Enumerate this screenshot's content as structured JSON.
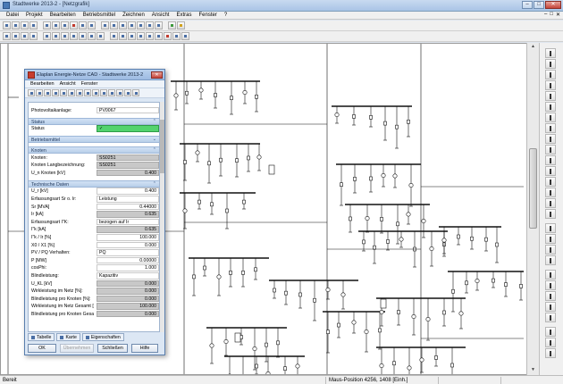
{
  "window": {
    "title": "Stadtwerke 2013-2 - [Netzgrafik]",
    "controls": [
      "–",
      "□",
      "✕"
    ]
  },
  "menu": {
    "items": [
      "Datei",
      "Projekt",
      "Bearbeiten",
      "Betriebsmittel",
      "Zeichnen",
      "Ansicht",
      "Extras",
      "Fenster",
      "?"
    ],
    "mdi_controls": [
      "–",
      "□",
      "✕"
    ]
  },
  "dialog": {
    "title": "Elaplan Energie-Netze CAD - Stadtwerke 2013-2",
    "menu": [
      "Bearbeiten",
      "Ansicht",
      "Fenster"
    ],
    "photovoltaik_label": "Photovoltaikanlage:",
    "photovoltaik_value": "PV0067",
    "sections": {
      "status": "Status",
      "betriebsmittel": "Betriebsmittel",
      "knoten": "Knoten",
      "technische_daten": "Technische Daten"
    },
    "status_row": {
      "label": "Status",
      "value": "✓"
    },
    "knoten_rows": [
      {
        "label": "Knoten:",
        "value": "SS0251",
        "style": "grey"
      },
      {
        "label": "Knoten Langbezeichnung:",
        "value": "SS0251",
        "style": "grey"
      },
      {
        "label": "U_n Knoten [kV]",
        "value": "0.400",
        "style": "grey num"
      }
    ],
    "tech_rows": [
      {
        "label": "U_r [kV]",
        "value": "0.400",
        "style": "num"
      },
      {
        "label": "Erfassungsart Sr o. Ir:",
        "value": "Leistung",
        "style": ""
      },
      {
        "label": "Sr [MVA]",
        "value": "0.44000",
        "style": "num"
      },
      {
        "label": "Ir [kA]",
        "value": "0.635",
        "style": "grey num"
      },
      {
        "label": "Erfassungsart I\"K:",
        "value": "bezogen auf Ir",
        "style": ""
      },
      {
        "label": "I\"k [kA]",
        "value": "0.635",
        "style": "grey num"
      },
      {
        "label": "I\"k / Ir [%]",
        "value": "100.000",
        "style": "num"
      },
      {
        "label": "X0 / X1 [%]",
        "value": "0.000",
        "style": "num"
      },
      {
        "label": "PV / PQ Verhalten:",
        "value": "PQ",
        "style": ""
      },
      {
        "label": "P [MW]",
        "value": "0.00000",
        "style": "num"
      },
      {
        "label": "cosPhi:",
        "value": "1.000",
        "style": "num"
      },
      {
        "label": "Blindleistung:",
        "value": "Kapazitiv",
        "style": ""
      },
      {
        "label": "U_KL [kV]",
        "value": "0.000",
        "style": "grey num"
      },
      {
        "label": "Wirkleistung im Netz [%]:",
        "value": "0.000",
        "style": "grey num"
      },
      {
        "label": "Blindleistung pro Knoten [%]:",
        "value": "0.000",
        "style": "grey num"
      },
      {
        "label": "Wirkleistung im Netz Gesamt [",
        "value": "100.000",
        "style": "grey num"
      },
      {
        "label": "Blindleistung pro Knoten Gesa",
        "value": "0.000",
        "style": "grey num"
      }
    ],
    "tabs": [
      "Tabelle",
      "Karte",
      "Eigenschaften"
    ],
    "buttons": [
      {
        "label": "OK",
        "disabled": false
      },
      {
        "label": "Übernehmen",
        "disabled": true
      },
      {
        "label": "Schließen",
        "disabled": false
      },
      {
        "label": "Hilfe",
        "disabled": false
      }
    ]
  },
  "statusbar": {
    "left": "Bereit",
    "position": "Maus-Position 4256, 1408 [Einh.]"
  },
  "colors": {
    "status_green": "#53d36e",
    "title_blue": "#a9c4e6",
    "net_line": "#111111"
  }
}
